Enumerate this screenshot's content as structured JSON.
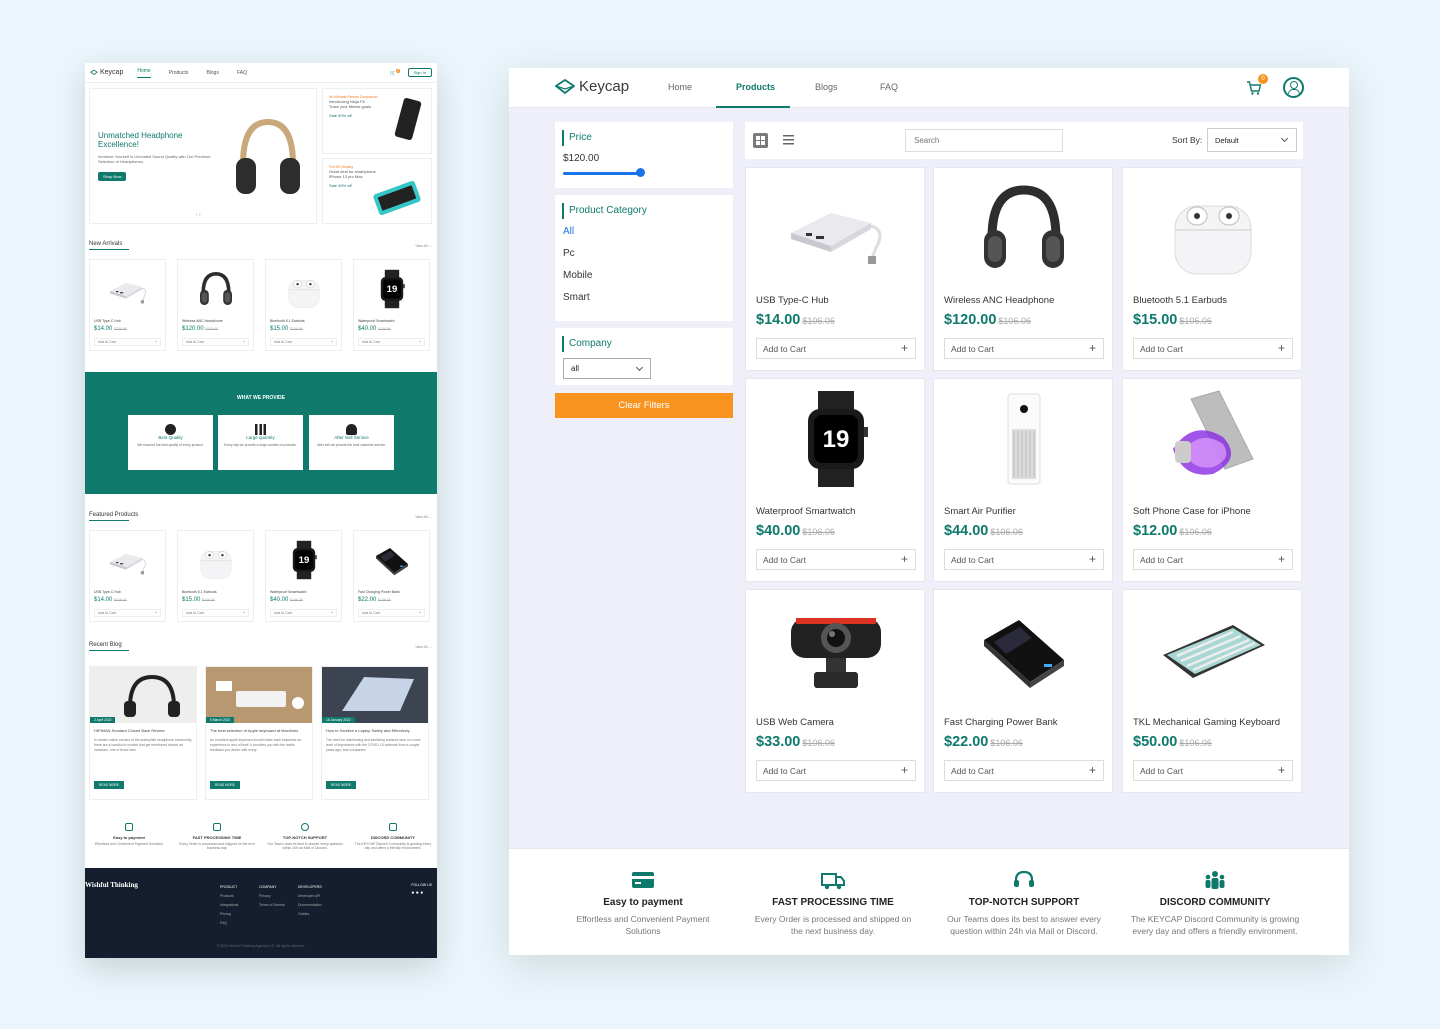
{
  "mini": {
    "nav": {
      "logo": "Keycap",
      "links": [
        "Home",
        "Products",
        "Blogs",
        "FAQ"
      ],
      "signin": "Sign In",
      "cart_badge": "0"
    },
    "hero": {
      "title": "Unmatched Headphone Excellence!",
      "text": "Immerse Yourself in Unrivaled Sound Quality with Our Premium Selection of Headphones.",
      "button": "Shop Now"
    },
    "promo1": {
      "tag": "Its Ultimate Fitness Companion",
      "line1": "Introducing Ninja Fit",
      "line2": "Track your fitness goals",
      "sale": "Sale 50% off"
    },
    "promo2": {
      "tag": "Full HD Display",
      "line1": "Great deal for smartphone",
      "line2": "iPhone 13 pro Max",
      "sale": "Sale 45% off"
    },
    "new_arrivals": "New Arrivals",
    "featured": "Featured Products",
    "recent_blog": "Recent Blog",
    "view_all": "View All",
    "arrivals": [
      {
        "name": "USB Type-C Hub",
        "price": "$14.00",
        "old": "$106.06"
      },
      {
        "name": "Wireless ANC Headphone",
        "price": "$120.00",
        "old": "$106.06"
      },
      {
        "name": "Bluetooth 5.1 Earbuds",
        "price": "$15.00",
        "old": "$106.06"
      },
      {
        "name": "Waterproof Smartwatch",
        "price": "$40.00",
        "old": "$106.06"
      }
    ],
    "featured_items": [
      {
        "name": "USB Type-C Hub",
        "price": "$14.00",
        "old": "$106.06"
      },
      {
        "name": "Bluetooth 5.1 Earbuds",
        "price": "$15.00",
        "old": "$106.06"
      },
      {
        "name": "Waterproof Smartwatch",
        "price": "$40.00",
        "old": "$106.06"
      },
      {
        "name": "Fast Charging Power Bank",
        "price": "$22.00",
        "old": "$106.06"
      }
    ],
    "add_to_cart": "Add to Cart",
    "provide": {
      "title": "WHAT WE PROVIDE",
      "items": [
        {
          "title": "Best Quality",
          "text": "We ensured the best quality of every product."
        },
        {
          "title": "Large quantity",
          "text": "Every day we provide a large number of products."
        },
        {
          "title": "After Sell Service",
          "text": "After sell we provide the best customer service."
        }
      ]
    },
    "blogs": [
      {
        "date": "2 April 2022",
        "title": "HIFIMAN Sundara Closed Back Review",
        "text": "In certain online corners of the audiophile headphone community, there are a handful of models that get mentioned almost ad nauseam, one of those bein"
      },
      {
        "date": "5 March 2022",
        "title": "The best selection of Apple keyboard at Machines",
        "text": "An excellent apple keyboard should make each keystroke an experience in and of itself. It provides you with the tactile feedback you desire with every"
      },
      {
        "date": "16 January 2022",
        "title": "How to Sanitize a Laptop Safely and Effectively",
        "text": "The need for disinfecting and sanitizing surfaces face on a new level of importance with the COVID-19 outbreak from a couple years ago, and companies"
      }
    ],
    "read_more": "READ MORE",
    "features": [
      {
        "title": "Easy to payment",
        "text": "Effortless and Convenient Payment Solutions"
      },
      {
        "title": "FAST PROCESSING TIME",
        "text": "Every Order is processed and shipped on the next business day."
      },
      {
        "title": "TOP-NOTCH SUPPORT",
        "text": "Our Teams does its best to answer every question within 24h via Mail or Discord."
      },
      {
        "title": "DISCORD COMMUNITY",
        "text": "The KEYCAP Discord Community is growing every day and offers a friendly environment."
      }
    ],
    "footer": {
      "brand": "Wishful Thinking",
      "cols": [
        {
          "title": "PRODUCT",
          "links": [
            "Products",
            "Integrations",
            "Pricing",
            "FAQ"
          ]
        },
        {
          "title": "COMPANY",
          "links": [
            "Privacy",
            "Terms of Service"
          ]
        },
        {
          "title": "DEVELOPERS",
          "links": [
            "Developer API",
            "Documentation",
            "Guides"
          ]
        }
      ],
      "follow": "FOLLOW US",
      "copyright": "© 2023 Wishful Thinking Agency LLC. All rights reserved."
    }
  },
  "app": {
    "logo": "Keycap",
    "nav": [
      {
        "label": "Home",
        "active": false
      },
      {
        "label": "Products",
        "active": true
      },
      {
        "label": "Blogs",
        "active": false
      },
      {
        "label": "FAQ",
        "active": false
      }
    ],
    "cart_count": "0",
    "filters": {
      "price_title": "Price",
      "price_value": "$120.00",
      "price_slider_fraction": 0.36,
      "category_title": "Product Category",
      "categories": [
        "All",
        "Pc",
        "Mobile",
        "Smart"
      ],
      "selected_category": "All",
      "company_title": "Company",
      "company_value": "all",
      "clear_label": "Clear Filters"
    },
    "toolbar": {
      "search_placeholder": "Search",
      "sort_label": "Sort By:",
      "sort_value": "Default"
    },
    "add_to_cart": "Add to Cart",
    "products": [
      {
        "name": "USB Type-C Hub",
        "price": "$14.00",
        "old": "$106.06",
        "icon": "usb-hub-icon"
      },
      {
        "name": "Wireless ANC Headphone",
        "price": "$120.00",
        "old": "$106.06",
        "icon": "headphone-icon"
      },
      {
        "name": "Bluetooth 5.1 Earbuds",
        "price": "$15.00",
        "old": "$106.06",
        "icon": "earbuds-icon"
      },
      {
        "name": "Waterproof Smartwatch",
        "price": "$40.00",
        "old": "$106.06",
        "icon": "smartwatch-icon"
      },
      {
        "name": "Smart Air Purifier",
        "price": "$44.00",
        "old": "$106.06",
        "icon": "air-purifier-icon"
      },
      {
        "name": "Soft Phone Case for iPhone",
        "price": "$12.00",
        "old": "$106.06",
        "icon": "phone-case-icon"
      },
      {
        "name": "USB Web Camera",
        "price": "$33.00",
        "old": "$106.06",
        "icon": "webcam-icon"
      },
      {
        "name": "Fast Charging Power Bank",
        "price": "$22.00",
        "old": "$106.06",
        "icon": "power-bank-icon"
      },
      {
        "name": "TKL Mechanical Gaming Keyboard",
        "price": "$50.00",
        "old": "$106.06",
        "icon": "keyboard-icon"
      }
    ],
    "features": [
      {
        "title": "Easy to payment",
        "text": "Effortless and Convenient Payment Solutions",
        "icon": "credit-card-icon"
      },
      {
        "title": "FAST PROCESSING TIME",
        "text": "Every Order is processed and shipped on the next business day.",
        "icon": "truck-icon"
      },
      {
        "title": "TOP-NOTCH SUPPORT",
        "text": "Our Teams does its best to answer every question within 24h via Mail or Discord.",
        "icon": "headset-icon"
      },
      {
        "title": "DISCORD COMMUNITY",
        "text": "The KEYCAP Discord Community is growing every day and offers a friendly environment.",
        "icon": "community-icon"
      }
    ],
    "colors": {
      "primary": "#0f7a6c",
      "accent": "#f7931e",
      "link": "#1a73e8"
    }
  }
}
